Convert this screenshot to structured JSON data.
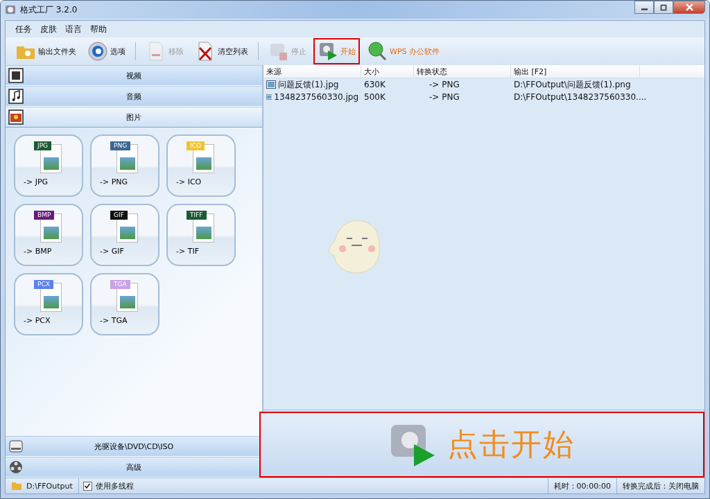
{
  "window": {
    "title": "格式工厂 3.2.0"
  },
  "menu": [
    "任务",
    "皮肤",
    "语言",
    "帮助"
  ],
  "toolbar": [
    {
      "label": "输出文件夹",
      "kind": "folder",
      "disabled": false,
      "highlighted": false
    },
    {
      "label": "选项",
      "kind": "gear",
      "disabled": false,
      "highlighted": false
    },
    {
      "label": "移除",
      "kind": "remove",
      "disabled": true,
      "highlighted": false
    },
    {
      "label": "清空列表",
      "kind": "clear",
      "disabled": false,
      "highlighted": false
    },
    {
      "label": "停止",
      "kind": "stop",
      "disabled": true,
      "highlighted": false
    },
    {
      "label": "开始",
      "kind": "start",
      "disabled": false,
      "highlighted": true
    },
    {
      "label": "WPS 办公软件",
      "kind": "globe",
      "disabled": false,
      "highlighted": false
    }
  ],
  "categories_top": [
    {
      "label": "视频",
      "kind": "video",
      "expanded": false
    },
    {
      "label": "音频",
      "kind": "audio",
      "expanded": false
    },
    {
      "label": "图片",
      "kind": "picture",
      "expanded": true
    }
  ],
  "image_formats": [
    {
      "tag": "JPG",
      "label": "-> JPG",
      "color": "#1c5a34"
    },
    {
      "tag": "PNG",
      "label": "-> PNG",
      "color": "#3b6792"
    },
    {
      "tag": "ICO",
      "label": "-> ICO",
      "color": "#f2c331"
    },
    {
      "tag": "BMP",
      "label": "-> BMP",
      "color": "#681a7e"
    },
    {
      "tag": "GIF",
      "label": "-> GIF",
      "color": "#111111"
    },
    {
      "tag": "TIFF",
      "label": "-> TIF",
      "color": "#1c5a34"
    },
    {
      "tag": "PCX",
      "label": "-> PCX",
      "color": "#5b82ee"
    },
    {
      "tag": "TGA",
      "label": "-> TGA",
      "color": "#c9a2e6"
    }
  ],
  "categories_bottom": [
    {
      "label": "光驱设备\\DVD\\CD\\ISO",
      "kind": "disc",
      "expanded": false
    },
    {
      "label": "高级",
      "kind": "reel",
      "expanded": false
    }
  ],
  "task_list": {
    "columns": [
      "来源",
      "大小",
      "转换状态",
      "输出 [F2]"
    ],
    "rows": [
      [
        "问题反馈(1).jpg",
        "630K",
        "-> PNG",
        "D:\\FFOutput\\问题反馈(1).png"
      ],
      [
        "1348237560330.jpg",
        "500K",
        "-> PNG",
        "D:\\FFOutput\\1348237560330...."
      ]
    ]
  },
  "start_panel": {
    "label": "点击开始",
    "highlighted": true
  },
  "status_bar": {
    "output_folder": "D:\\FFOutput",
    "multithread": {
      "label": "使用多线程",
      "checked": true
    },
    "elapsed": "耗时：00:00:00",
    "after_done": "转换完成后：关闭电脑"
  }
}
